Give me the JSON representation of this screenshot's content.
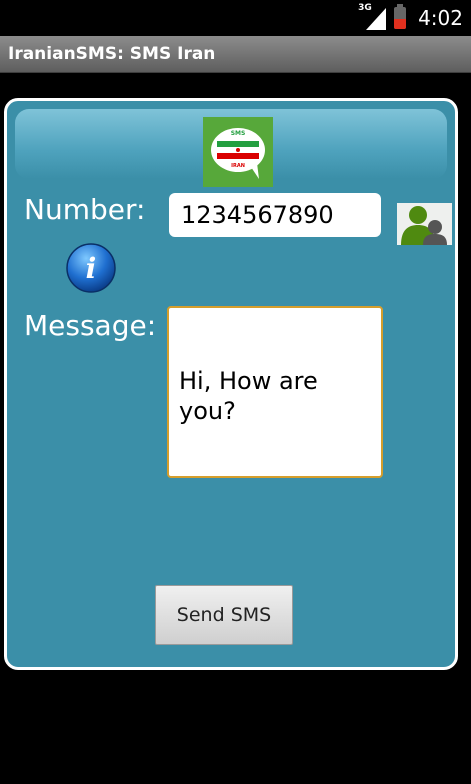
{
  "status_bar": {
    "network": "3G",
    "time": "4:02"
  },
  "app": {
    "title": "IranianSMS: SMS Iran"
  },
  "form": {
    "number_label": "Number:",
    "number_value": "1234567890",
    "message_label": "Message:",
    "message_value": "Hi, How are you?",
    "send_button": "Send SMS"
  },
  "logo": {
    "top_text": "SMS",
    "bottom_text": "IRAN"
  },
  "icons": {
    "contacts": "contacts-icon",
    "info": "info-icon",
    "signal": "signal-icon",
    "battery": "battery-icon"
  },
  "colors": {
    "panel": "#3b8fa8",
    "title_bar": "#6e6e6e",
    "logo_green": "#57a83a",
    "message_border": "#d59e2c"
  }
}
